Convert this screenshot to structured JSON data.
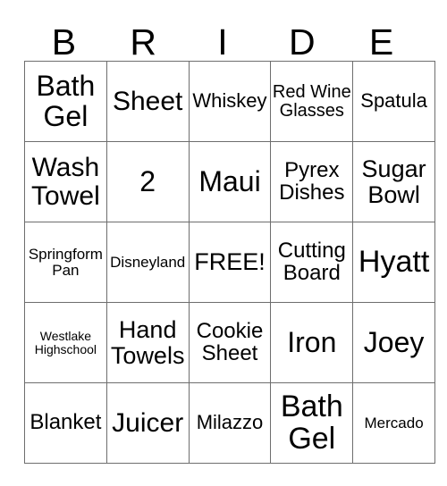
{
  "card": {
    "title_letters": [
      "B",
      "R",
      "I",
      "D",
      "E"
    ],
    "border_color": "#6e6e6e",
    "text_color": "#000000",
    "background_color": "#ffffff",
    "free_space_label": "FREE!",
    "rows": [
      [
        {
          "text": "Bath Gel",
          "size": "fs-32"
        },
        {
          "text": "Sheet",
          "size": "fs-30"
        },
        {
          "text": "Whiskey",
          "size": "fs-22"
        },
        {
          "text": "Red Wine Glasses",
          "size": "fs-20"
        },
        {
          "text": "Spatula",
          "size": "fs-22"
        }
      ],
      [
        {
          "text": "Wash Towel",
          "size": "fs-30"
        },
        {
          "text": "2",
          "size": "fs-32"
        },
        {
          "text": "Maui",
          "size": "fs-32"
        },
        {
          "text": "Pyrex Dishes",
          "size": "fs-24"
        },
        {
          "text": "Sugar Bowl",
          "size": "fs-27"
        }
      ],
      [
        {
          "text": "Springform Pan",
          "size": "fs-17"
        },
        {
          "text": "Disneyland",
          "size": "fs-17"
        },
        {
          "text": "FREE!",
          "size": "fs-27"
        },
        {
          "text": "Cutting Board",
          "size": "fs-24"
        },
        {
          "text": "Hyatt",
          "size": "fs-34"
        }
      ],
      [
        {
          "text": "Westlake Highschool",
          "size": "fs-14"
        },
        {
          "text": "Hand Towels",
          "size": "fs-27"
        },
        {
          "text": "Cookie Sheet",
          "size": "fs-24"
        },
        {
          "text": "Iron",
          "size": "fs-32"
        },
        {
          "text": "Joey",
          "size": "fs-32"
        }
      ],
      [
        {
          "text": "Blanket",
          "size": "fs-24"
        },
        {
          "text": "Juicer",
          "size": "fs-30"
        },
        {
          "text": "Milazzo",
          "size": "fs-22"
        },
        {
          "text": "Bath Gel",
          "size": "fs-34"
        },
        {
          "text": "Mercado",
          "size": "fs-17"
        }
      ]
    ]
  }
}
